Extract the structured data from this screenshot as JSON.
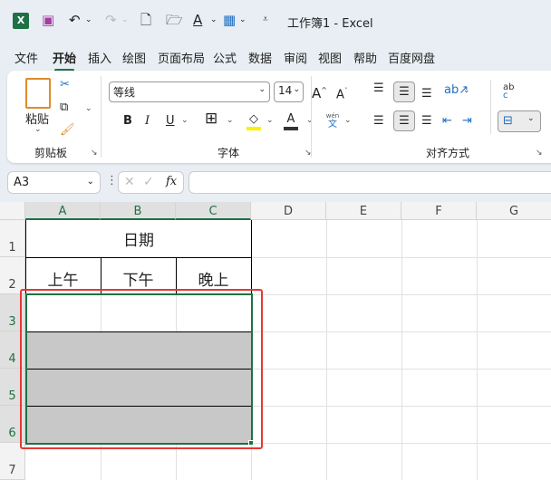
{
  "window": {
    "title": "工作簿1  -  Excel"
  },
  "tabs": [
    {
      "label": "文件"
    },
    {
      "label": "开始",
      "active": true
    },
    {
      "label": "插入"
    },
    {
      "label": "绘图"
    },
    {
      "label": "页面布局"
    },
    {
      "label": "公式"
    },
    {
      "label": "数据"
    },
    {
      "label": "审阅"
    },
    {
      "label": "视图"
    },
    {
      "label": "帮助"
    },
    {
      "label": "百度网盘"
    }
  ],
  "ribbon": {
    "clipboard": {
      "label": "剪贴板",
      "paste": "粘贴"
    },
    "font": {
      "label": "字体",
      "font_name": "等线",
      "font_size": "14",
      "bold": "B",
      "italic": "I",
      "underline": "U",
      "phonetic_top": "wén",
      "phonetic_bottom": "文"
    },
    "alignment": {
      "label": "对齐方式",
      "wrap_top": "ab",
      "wrap_bottom": "c"
    }
  },
  "formula_bar": {
    "name_box": "A3",
    "fx": "fx",
    "value": ""
  },
  "sheet": {
    "columns": [
      "A",
      "B",
      "C",
      "D",
      "E",
      "F",
      "G"
    ],
    "rows": [
      "1",
      "2",
      "3",
      "4",
      "5",
      "6",
      "7"
    ],
    "cells": {
      "A1": "日期",
      "A2": "上午",
      "B2": "下午",
      "C2": "晚上"
    },
    "selection": "A3:C6",
    "fill_color": "#c8c8c8",
    "accent": "#1e7145",
    "highlight_color": "#e53935"
  }
}
